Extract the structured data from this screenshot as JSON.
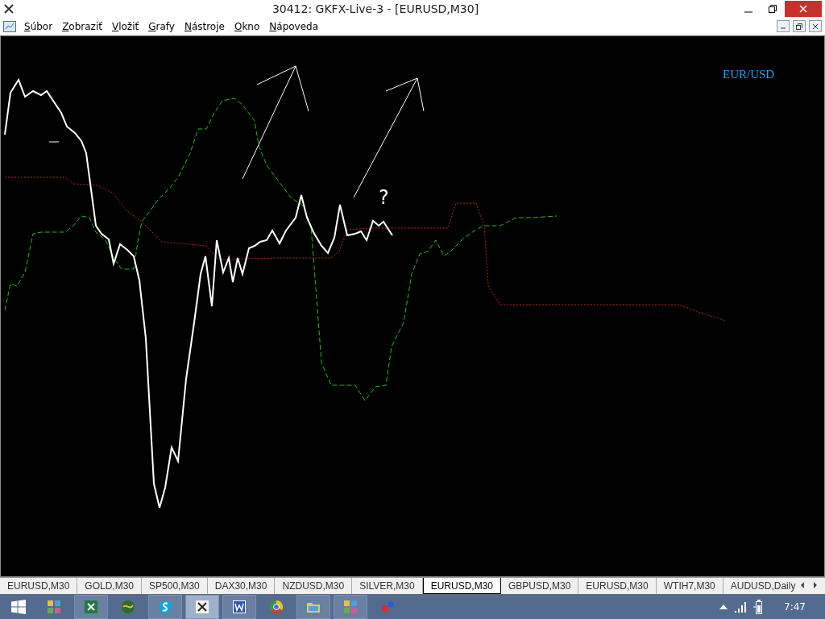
{
  "window": {
    "title": "30412: GKFX-Live-3 - [EURUSD,M30]"
  },
  "menu": [
    "Súbor",
    "Zobraziť",
    "Vložiť",
    "Grafy",
    "Nástroje",
    "Okno",
    "Nápoveda"
  ],
  "chart": {
    "symbol": "EUR/USD",
    "annotation": "?"
  },
  "tabs": [
    {
      "label": "EURUSD,M30",
      "selected": false
    },
    {
      "label": "GOLD,M30",
      "selected": false
    },
    {
      "label": "SP500,M30",
      "selected": false
    },
    {
      "label": "DAX30,M30",
      "selected": false
    },
    {
      "label": "NZDUSD,M30",
      "selected": false
    },
    {
      "label": "SILVER,M30",
      "selected": false
    },
    {
      "label": "EURUSD,M30",
      "selected": true
    },
    {
      "label": "GBPUSD,M30",
      "selected": false
    },
    {
      "label": "EURUSD,M30",
      "selected": false
    },
    {
      "label": "WTIH7,M30",
      "selected": false
    },
    {
      "label": "AUDUSD,Daily",
      "selected": false
    }
  ],
  "taskbar": {
    "items": [
      {
        "kind": "tiles",
        "running": false,
        "selected": false
      },
      {
        "kind": "sheet",
        "running": true,
        "selected": false
      },
      {
        "kind": "globe",
        "running": false,
        "selected": false
      },
      {
        "kind": "chat",
        "running": true,
        "selected": false
      },
      {
        "kind": "cross",
        "running": true,
        "selected": true
      },
      {
        "kind": "doc",
        "running": true,
        "selected": false
      },
      {
        "kind": "browser",
        "running": false,
        "selected": false
      },
      {
        "kind": "folder",
        "running": true,
        "selected": false
      },
      {
        "kind": "tiles",
        "running": true,
        "selected": false
      },
      {
        "kind": "dots",
        "running": false,
        "selected": false
      }
    ],
    "clock": "7:47"
  }
}
